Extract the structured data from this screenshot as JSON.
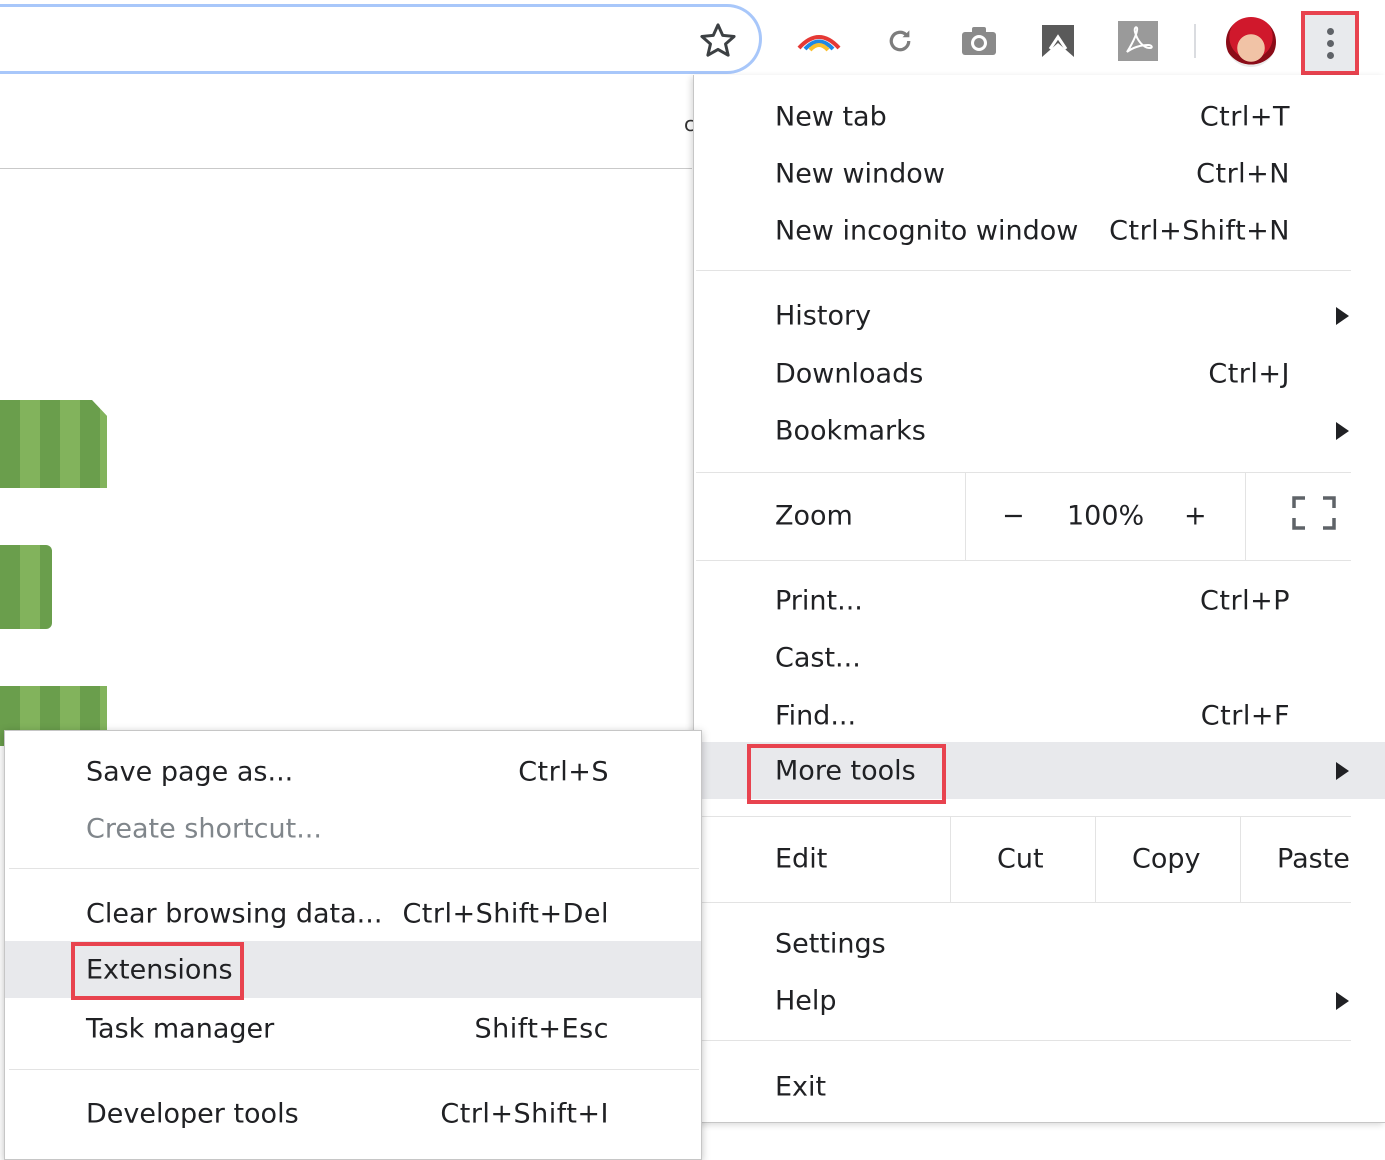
{
  "toolbar": {
    "icons": [
      "star-icon",
      "rainbow-extension-icon",
      "reload-extension-icon",
      "camera-extension-icon",
      "bookmark-extension-icon",
      "acrobat-extension-icon",
      "avatar",
      "kebab-menu-icon"
    ]
  },
  "page": {
    "partial_text": "c"
  },
  "main_menu": {
    "new_tab": {
      "label": "New tab",
      "shortcut": "Ctrl+T"
    },
    "new_window": {
      "label": "New window",
      "shortcut": "Ctrl+N"
    },
    "new_incognito": {
      "label": "New incognito window",
      "shortcut": "Ctrl+Shift+N"
    },
    "history": {
      "label": "History"
    },
    "downloads": {
      "label": "Downloads",
      "shortcut": "Ctrl+J"
    },
    "bookmarks": {
      "label": "Bookmarks"
    },
    "zoom": {
      "label": "Zoom",
      "minus": "−",
      "value": "100%",
      "plus": "+"
    },
    "print": {
      "label": "Print...",
      "shortcut": "Ctrl+P"
    },
    "cast": {
      "label": "Cast..."
    },
    "find": {
      "label": "Find...",
      "shortcut": "Ctrl+F"
    },
    "more_tools": {
      "label": "More tools"
    },
    "edit": {
      "label": "Edit",
      "cut": "Cut",
      "copy": "Copy",
      "paste": "Paste"
    },
    "settings": {
      "label": "Settings"
    },
    "help": {
      "label": "Help"
    },
    "exit": {
      "label": "Exit"
    }
  },
  "sub_menu": {
    "save_page": {
      "label": "Save page as...",
      "shortcut": "Ctrl+S"
    },
    "create_shortcut": {
      "label": "Create shortcut..."
    },
    "clear_browsing": {
      "label": "Clear browsing data...",
      "shortcut": "Ctrl+Shift+Del"
    },
    "extensions": {
      "label": "Extensions"
    },
    "task_manager": {
      "label": "Task manager",
      "shortcut": "Shift+Esc"
    },
    "developer_tools": {
      "label": "Developer tools",
      "shortcut": "Ctrl+Shift+I"
    }
  },
  "colors": {
    "highlight_box": "#e8434f",
    "hover_bg": "#e8e9ec",
    "omnibox_border": "#a8c7fa"
  }
}
